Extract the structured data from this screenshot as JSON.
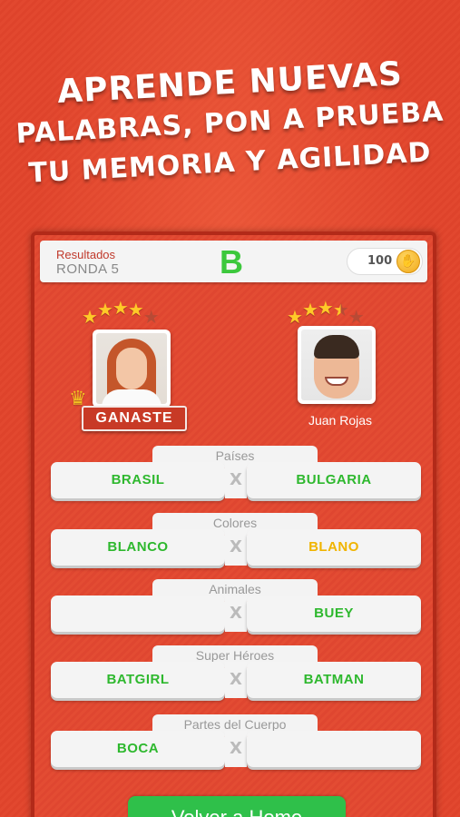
{
  "headline": {
    "line1": "APRENDE NUEVAS",
    "line2": "PALABRAS, PON A PRUEBA",
    "line3": "TU MEMORIA Y AGILIDAD"
  },
  "header": {
    "title": "Resultados",
    "round": "RONDA 5",
    "letter": "B",
    "coins": "100"
  },
  "players": {
    "player1": {
      "rating": 4,
      "max_rating": 5,
      "badge": "GANASTE"
    },
    "player2": {
      "name": "Juan Rojas",
      "rating": 3.5,
      "max_rating": 5
    }
  },
  "rounds": [
    {
      "category": "Países",
      "left": "BRASIL",
      "right": "BULGARIA",
      "left_status": "correct",
      "right_status": "correct"
    },
    {
      "category": "Colores",
      "left": "BLANCO",
      "right": "BLANO",
      "left_status": "correct",
      "right_status": "partial"
    },
    {
      "category": "Animales",
      "left": "",
      "right": "BUEY",
      "left_status": "empty",
      "right_status": "correct"
    },
    {
      "category": "Super Héroes",
      "left": "BATGIRL",
      "right": "BATMAN",
      "left_status": "correct",
      "right_status": "correct"
    },
    {
      "category": "Partes del Cuerpo",
      "left": "BOCA",
      "right": "",
      "left_status": "correct",
      "right_status": "empty"
    }
  ],
  "vs_symbol": "X",
  "footer": {
    "button_label": "Volver a Home"
  },
  "colors": {
    "correct": "#2eb82e",
    "partial": "#f0b400",
    "accent": "#e2482f"
  }
}
